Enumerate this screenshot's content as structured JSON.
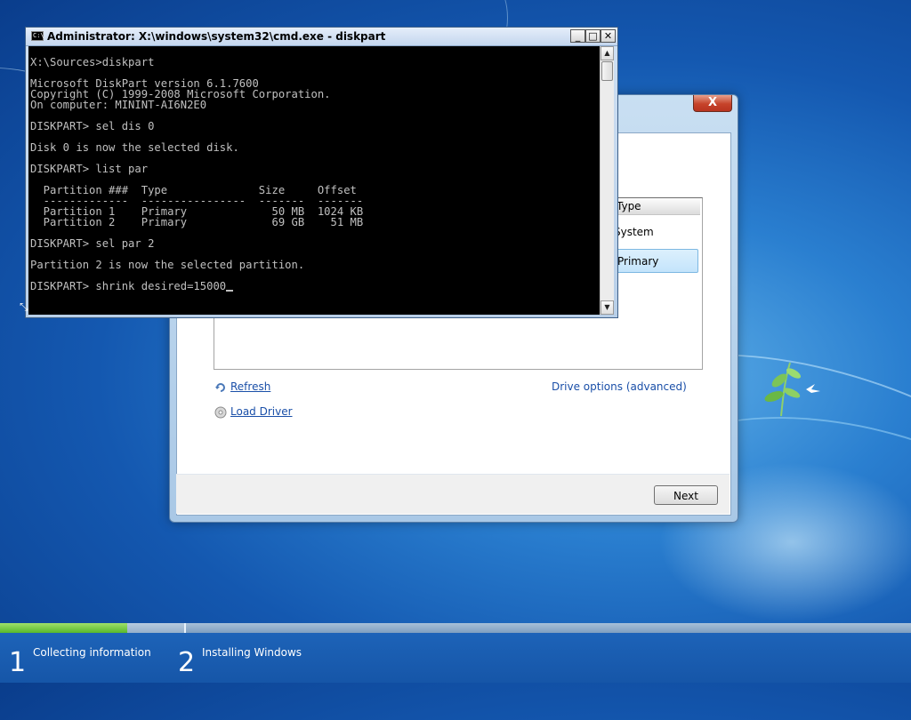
{
  "cmd": {
    "title": "Administrator: X:\\windows\\system32\\cmd.exe - diskpart",
    "icon_label": "C:\\",
    "minimize_label": "_",
    "maximize_label": "□",
    "close_label": "✕",
    "lines": [
      "",
      "X:\\Sources>diskpart",
      "",
      "Microsoft DiskPart version 6.1.7600",
      "Copyright (C) 1999-2008 Microsoft Corporation.",
      "On computer: MININT-AI6N2E0",
      "",
      "DISKPART> sel dis 0",
      "",
      "Disk 0 is now the selected disk.",
      "",
      "DISKPART> list par",
      "",
      "  Partition ###  Type              Size     Offset",
      "  -------------  ----------------  -------  -------",
      "  Partition 1    Primary             50 MB  1024 KB",
      "  Partition 2    Primary             69 GB    51 MB",
      "",
      "DISKPART> sel par 2",
      "",
      "Partition 2 is now the selected partition.",
      "",
      "DISKPART> shrink desired=15000"
    ]
  },
  "setup": {
    "close_label": "X",
    "column_type": "Type",
    "row_system": "System",
    "row_primary": "Primary",
    "refresh_label": "Refresh",
    "load_driver_label": "Load Driver",
    "drive_options_label": "Drive options (advanced)",
    "next_label": "Next"
  },
  "progress": {
    "fraction": 0.14,
    "steps": [
      {
        "number": "1",
        "label": "Collecting information"
      },
      {
        "number": "2",
        "label": "Installing Windows"
      }
    ]
  },
  "colors": {
    "progress_green": "#58b82c",
    "link_blue": "#1a4fa8",
    "console_text": "#c0c0c0"
  }
}
